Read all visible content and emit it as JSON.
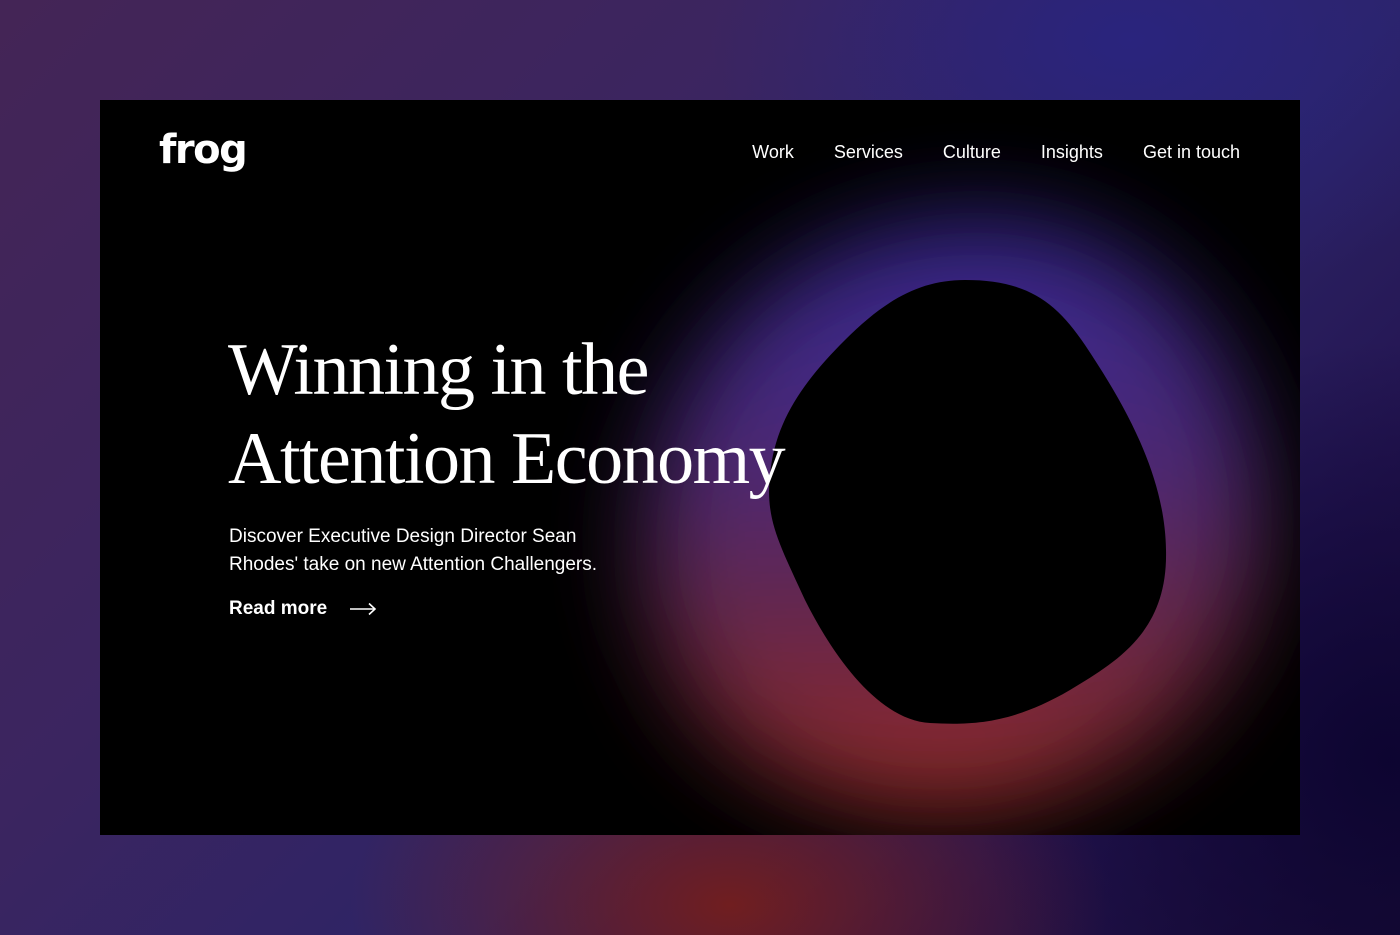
{
  "brand": {
    "logo_text": "frog"
  },
  "nav": {
    "items": [
      {
        "label": "Work"
      },
      {
        "label": "Services"
      },
      {
        "label": "Culture"
      },
      {
        "label": "Insights"
      },
      {
        "label": "Get in touch"
      }
    ]
  },
  "hero": {
    "headline_line1": "Winning in the",
    "headline_line2": "Attention Economy",
    "description": "Discover Executive Design Director Sean Rhodes' take on new Attention Challengers.",
    "cta_label": "Read more",
    "cta_icon": "arrow-right-icon"
  },
  "colors": {
    "frame_background": "#000000",
    "glow_top": "#3a2a9c",
    "glow_mid": "#5a2a6e",
    "glow_bottom": "#a3302a",
    "text": "#ffffff"
  }
}
